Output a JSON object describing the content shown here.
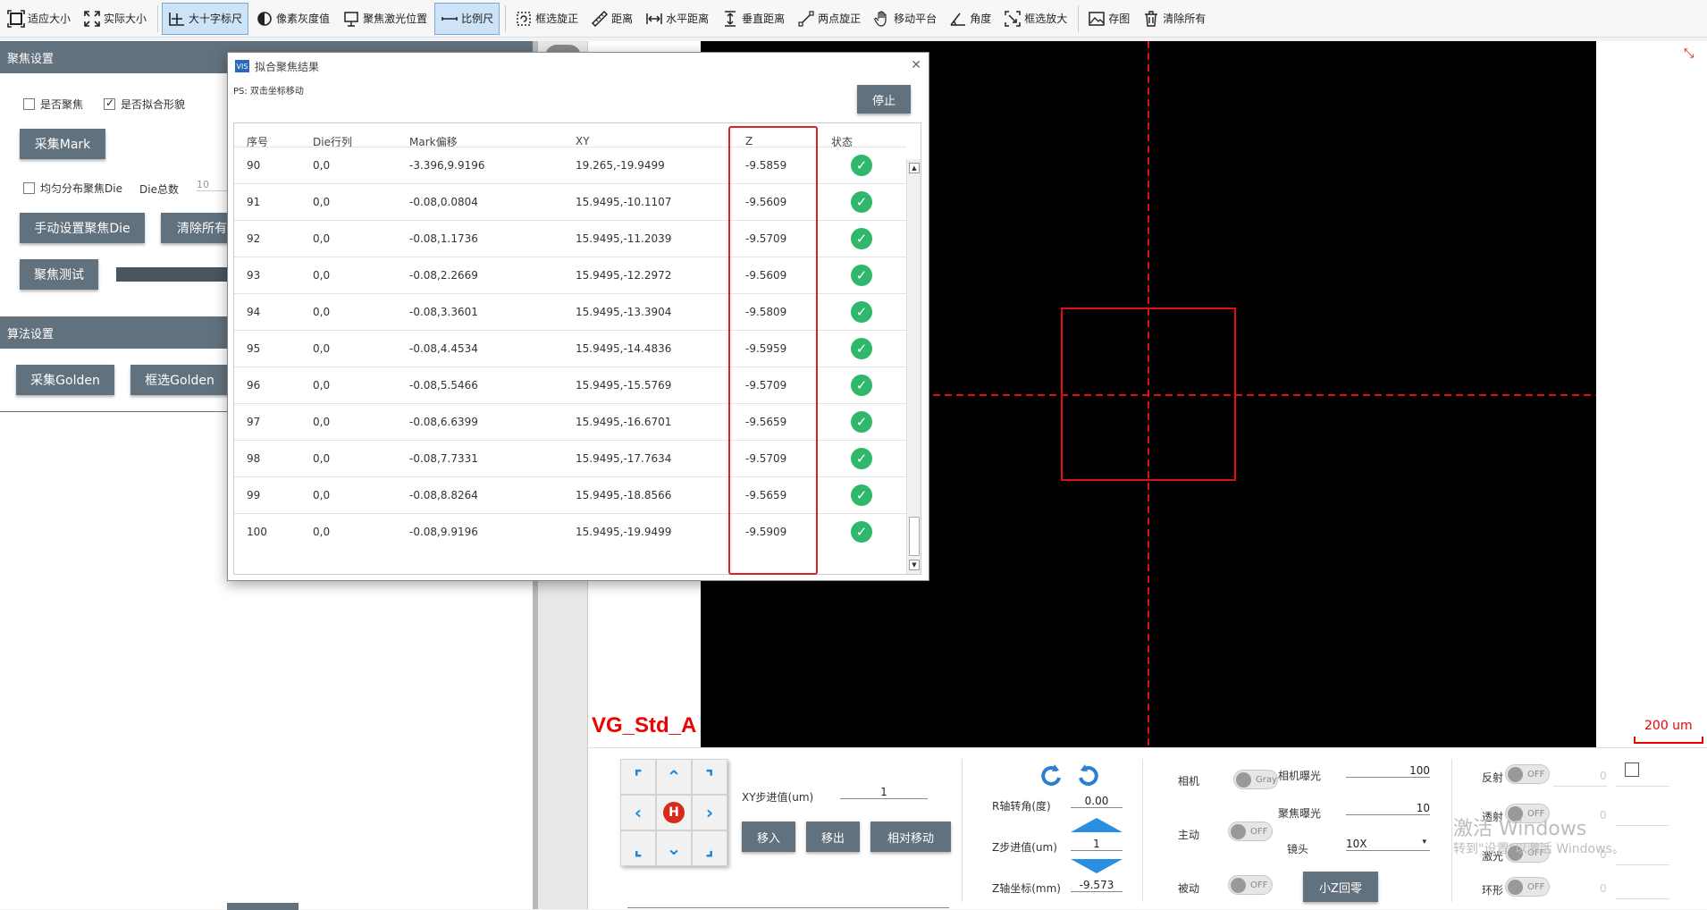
{
  "toolbar": {
    "fit": "适应大小",
    "actual": "实际大小",
    "crosshair": "大十字标尺",
    "gray": "像素灰度值",
    "laser": "聚焦激光位置",
    "ruler": "比例尺",
    "rect_rotate": "框选旋正",
    "distance": "距离",
    "hdist": "水平距离",
    "vdist": "垂直距离",
    "two_point": "两点旋正",
    "move_stage": "移动平台",
    "angle": "角度",
    "zoom_box": "框选放大",
    "save": "存图",
    "clear_all": "清除所有"
  },
  "left": {
    "focus_section": "聚焦设置",
    "focus_cb": "是否聚焦",
    "fit_cb": "是否拟合形貌",
    "collect_mark": "采集Mark",
    "uniform_cb": "均匀分布聚焦Die",
    "die_total_label": "Die总数",
    "die_total_value": "10",
    "manual_die": "手动设置聚焦Die",
    "clear_all": "清除所有",
    "focus_test": "聚焦测试",
    "algo_section": "算法设置",
    "collect_golden": "采集Golden",
    "select_golden": "框选Golden"
  },
  "dialog": {
    "title": "拟合聚焦结果",
    "logo": "VIS",
    "ps": "PS: 双击坐标移动",
    "stop": "停止",
    "headers": [
      "序号",
      "Die行列",
      "Mark偏移",
      "XY",
      "Z",
      "状态"
    ],
    "rows": [
      {
        "idx": "90",
        "die": "0,0",
        "mark": "-3.396,9.9196",
        "xy": "19.265,-19.9499",
        "z": "-9.5859"
      },
      {
        "idx": "91",
        "die": "0,0",
        "mark": "-0.08,0.0804",
        "xy": "15.9495,-10.1107",
        "z": "-9.5609"
      },
      {
        "idx": "92",
        "die": "0,0",
        "mark": "-0.08,1.1736",
        "xy": "15.9495,-11.2039",
        "z": "-9.5709"
      },
      {
        "idx": "93",
        "die": "0,0",
        "mark": "-0.08,2.2669",
        "xy": "15.9495,-12.2972",
        "z": "-9.5609"
      },
      {
        "idx": "94",
        "die": "0,0",
        "mark": "-0.08,3.3601",
        "xy": "15.9495,-13.3904",
        "z": "-9.5809"
      },
      {
        "idx": "95",
        "die": "0,0",
        "mark": "-0.08,4.4534",
        "xy": "15.9495,-14.4836",
        "z": "-9.5959"
      },
      {
        "idx": "96",
        "die": "0,0",
        "mark": "-0.08,5.5466",
        "xy": "15.9495,-15.5769",
        "z": "-9.5709"
      },
      {
        "idx": "97",
        "die": "0,0",
        "mark": "-0.08,6.6399",
        "xy": "15.9495,-16.6701",
        "z": "-9.5659"
      },
      {
        "idx": "98",
        "die": "0,0",
        "mark": "-0.08,7.7331",
        "xy": "15.9495,-17.7634",
        "z": "-9.5709"
      },
      {
        "idx": "99",
        "die": "0,0",
        "mark": "-0.08,8.8264",
        "xy": "15.9495,-18.8566",
        "z": "-9.5659"
      },
      {
        "idx": "100",
        "die": "0,0",
        "mark": "-0.08,9.9196",
        "xy": "15.9495,-19.9499",
        "z": "-9.5909"
      }
    ]
  },
  "camera": {
    "title": "VG_Std_A",
    "scale": "200 um"
  },
  "bottom": {
    "xy_step_label": "XY步进值(um)",
    "xy_step_value": "1",
    "move_in": "移入",
    "move_out": "移出",
    "rel_move": "相对移动",
    "r_angle_label": "R轴转角(度)",
    "r_angle_value": "0.00",
    "z_step_label": "Z步进值(um)",
    "z_step_value": "1",
    "z_coord_label": "Z轴坐标(mm)",
    "z_coord_value": "-9.573",
    "camera_label": "相机",
    "camera_toggle": "Gray",
    "exposure_label": "相机曝光",
    "exposure_value": "100",
    "focus_exposure_label": "聚焦曝光",
    "focus_exposure_value": "10",
    "active_label": "主动",
    "active_toggle": "OFF",
    "lens_label": "镜头",
    "lens_value": "10X",
    "passive_label": "被动",
    "passive_toggle": "OFF",
    "small_z_home": "小Z回零",
    "reflect_label": "反射",
    "reflect_toggle": "OFF",
    "reflect_value": "0",
    "transmit_label": "透射",
    "transmit_toggle": "OFF",
    "transmit_value": "0",
    "laser_label": "激光",
    "laser_toggle": "OFF",
    "laser_value": "0",
    "ring_label": "环形",
    "ring_toggle": "OFF",
    "ring_value": "0",
    "watermark": "激活 Windows",
    "watermark_sub": "转到\"设置\"以激活 Windows。"
  }
}
